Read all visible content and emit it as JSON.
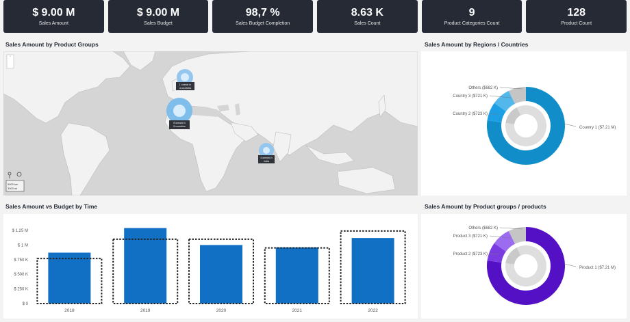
{
  "kpis": [
    {
      "value": "$ 9.00 M",
      "label": "Sales Amount"
    },
    {
      "value": "$ 9.00 M",
      "label": "Sales Budget"
    },
    {
      "value": "98,7 %",
      "label": "Sales Budget Completion"
    },
    {
      "value": "8.63 K",
      "label": "Sales Count"
    },
    {
      "value": "9",
      "label": "Product Categories Count"
    },
    {
      "value": "128",
      "label": "Product Count"
    }
  ],
  "titles": {
    "map": "Sales Amount by Product Groups",
    "regions": "Sales Amount by Regions / Countries",
    "budget": "Sales Amount vs Budget by Time",
    "products": "Sales Amount by Product groups / products"
  },
  "map": {
    "bubbles": [
      {
        "label1": "1 onesin in",
        "label2": "4 countries"
      },
      {
        "label1": "8 onesin in",
        "label2": "5 countries"
      },
      {
        "label1": "4 onesin in",
        "label2": "India"
      }
    ],
    "scale1": "5000 km",
    "scale2": "3000 mi"
  },
  "colors": {
    "accent": "#1280c8",
    "kpi_bg": "#252a35",
    "purple": "#5a16c7",
    "grey": "#c8c8c8"
  },
  "chart_data": [
    {
      "type": "pie",
      "title": "Sales Amount by Regions / Countries",
      "categories": [
        "Country 1",
        "Country 2",
        "Country 3",
        "Others"
      ],
      "labels": [
        "Country 1 ($7.21 M)",
        "Country 2 ($723 K)",
        "Country 3 ($721 K)",
        "Others ($682 K)"
      ],
      "values": [
        7.21,
        0.723,
        0.721,
        0.682
      ],
      "colors": [
        "#118dca",
        "#1c9fe4",
        "#52b7ea",
        "#c5c5c5"
      ]
    },
    {
      "type": "bar",
      "title": "Sales Amount vs Budget by Time",
      "categories": [
        "2018",
        "2019",
        "2020",
        "2021",
        "2022"
      ],
      "series": [
        {
          "values": [
            870000,
            1290000,
            1000000,
            960000,
            1120000
          ]
        },
        {
          "values": [
            770000,
            1100000,
            1100000,
            950000,
            1240000
          ]
        }
      ],
      "yticks": [
        "$ 0",
        "$ 250 K",
        "$ 500 K",
        "$ 750 K",
        "$ 1 M",
        "$ 1.25 M"
      ],
      "ylim": [
        0,
        1250000
      ]
    },
    {
      "type": "pie",
      "title": "Sales Amount by Product groups / products",
      "categories": [
        "Product 1",
        "Product 2",
        "Product 3",
        "Others"
      ],
      "labels": [
        "Product 1 ($7.21 M)",
        "Product 2 ($723 K)",
        "Product 3 ($721 K)",
        "Others ($682 K)"
      ],
      "values": [
        7.21,
        0.723,
        0.721,
        0.682
      ],
      "colors": [
        "#5410c4",
        "#7a3ce0",
        "#9c6cf0",
        "#c5c5c5"
      ]
    }
  ]
}
